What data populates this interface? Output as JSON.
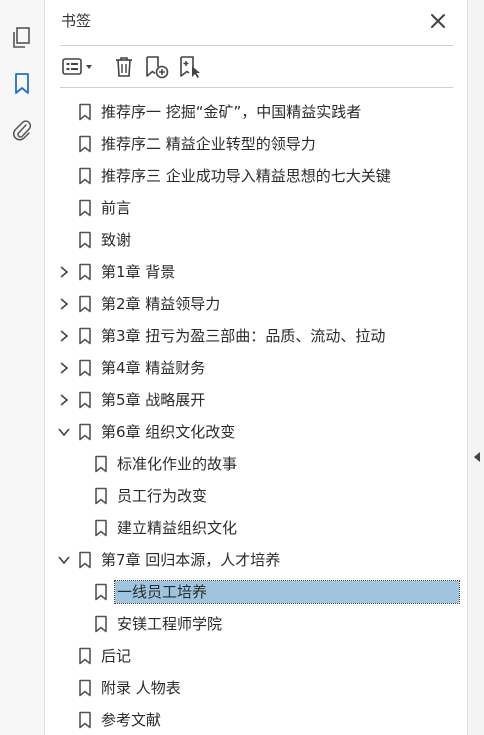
{
  "panel": {
    "title": "书签"
  },
  "rail": {
    "items": [
      {
        "icon": "page-thumbnails-icon"
      },
      {
        "icon": "bookmark-icon",
        "active": true
      },
      {
        "icon": "attachment-icon"
      }
    ]
  },
  "toolbar": {
    "buttons": [
      "options-menu-icon",
      "delete-bookmark-icon",
      "new-bookmark-icon",
      "bookmark-from-selection-icon"
    ]
  },
  "bookmarks": [
    {
      "label": "推荐序一 挖掘“金矿”，中国精益实践者",
      "level": 0,
      "expandable": false
    },
    {
      "label": "推荐序二 精益企业转型的领导力",
      "level": 0,
      "expandable": false
    },
    {
      "label": "推荐序三 企业成功导入精益思想的七大关键",
      "level": 0,
      "expandable": false
    },
    {
      "label": "前言",
      "level": 0,
      "expandable": false
    },
    {
      "label": "致谢",
      "level": 0,
      "expandable": false
    },
    {
      "label": "第1章 背景",
      "level": 0,
      "expandable": true,
      "expanded": false
    },
    {
      "label": "第2章 精益领导力",
      "level": 0,
      "expandable": true,
      "expanded": false
    },
    {
      "label": "第3章 扭亏为盈三部曲：品质、流动、拉动",
      "level": 0,
      "expandable": true,
      "expanded": false
    },
    {
      "label": "第4章 精益财务",
      "level": 0,
      "expandable": true,
      "expanded": false
    },
    {
      "label": "第5章 战略展开",
      "level": 0,
      "expandable": true,
      "expanded": false
    },
    {
      "label": "第6章 组织文化改变",
      "level": 0,
      "expandable": true,
      "expanded": true
    },
    {
      "label": "标准化作业的故事",
      "level": 1,
      "expandable": false
    },
    {
      "label": "员工行为改变",
      "level": 1,
      "expandable": false
    },
    {
      "label": "建立精益组织文化",
      "level": 1,
      "expandable": false
    },
    {
      "label": "第7章 回归本源，人才培养",
      "level": 0,
      "expandable": true,
      "expanded": true
    },
    {
      "label": "一线员工培养",
      "level": 1,
      "expandable": false,
      "selected": true
    },
    {
      "label": "安镁工程师学院",
      "level": 1,
      "expandable": false
    },
    {
      "label": "后记",
      "level": 0,
      "expandable": false
    },
    {
      "label": "附录 人物表",
      "level": 0,
      "expandable": false
    },
    {
      "label": "参考文献",
      "level": 0,
      "expandable": false
    }
  ],
  "colors": {
    "selection": "#9fc4e0",
    "active_icon": "#1f6fd0"
  }
}
